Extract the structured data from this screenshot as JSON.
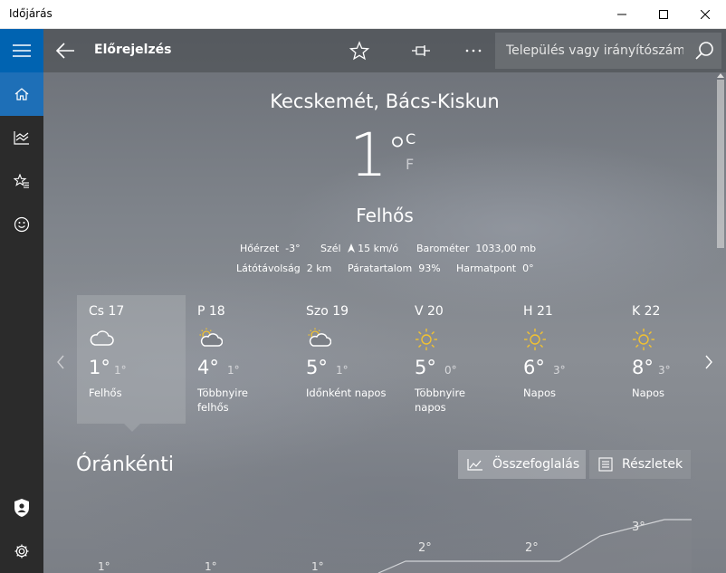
{
  "window": {
    "title": "Időjárás"
  },
  "header": {
    "title": "Előrejelzés",
    "search_placeholder": "Település vagy irányítószám"
  },
  "current": {
    "location": "Kecskemét, Bács-Kiskun",
    "temperature": "1",
    "degree": "°",
    "unit_c": "C",
    "unit_f": "F",
    "condition": "Felhős",
    "details": {
      "feels_like_label": "Hőérzet",
      "feels_like_value": "-3°",
      "wind_label": "Szél",
      "wind_value": "15 km/ó",
      "barometer_label": "Barométer",
      "barometer_value": "1033,00 mb",
      "visibility_label": "Látótávolság",
      "visibility_value": "2 km",
      "humidity_label": "Páratartalom",
      "humidity_value": "93%",
      "dewpoint_label": "Harmatpont",
      "dewpoint_value": "0°"
    }
  },
  "forecast": [
    {
      "day": "Cs 17",
      "high": "1°",
      "low": "1°",
      "desc1": "Felhős",
      "desc2": "",
      "icon": "cloud-icon"
    },
    {
      "day": "P 18",
      "high": "4°",
      "low": "1°",
      "desc1": "Többnyire",
      "desc2": "felhős",
      "icon": "partly-cloudy-icon"
    },
    {
      "day": "Szo 19",
      "high": "5°",
      "low": "1°",
      "desc1": "Időnként napos",
      "desc2": "",
      "icon": "partly-cloudy-icon"
    },
    {
      "day": "V 20",
      "high": "5°",
      "low": "0°",
      "desc1": "Többnyire",
      "desc2": "napos",
      "icon": "sun-icon"
    },
    {
      "day": "H 21",
      "high": "6°",
      "low": "3°",
      "desc1": "Napos",
      "desc2": "",
      "icon": "sun-icon"
    },
    {
      "day": "K 22",
      "high": "8°",
      "low": "3°",
      "desc1": "Napos",
      "desc2": "",
      "icon": "sun-icon"
    }
  ],
  "hourly": {
    "title": "Óránkénti",
    "summary_label": "Összefoglalás",
    "details_label": "Részletek",
    "points": [
      "1°",
      "1°",
      "1°",
      "2°",
      "2°",
      "3°"
    ]
  },
  "colors": {
    "accent": "#0063b1",
    "sun": "#f2c230",
    "sidebar": "#2b2b2b"
  }
}
